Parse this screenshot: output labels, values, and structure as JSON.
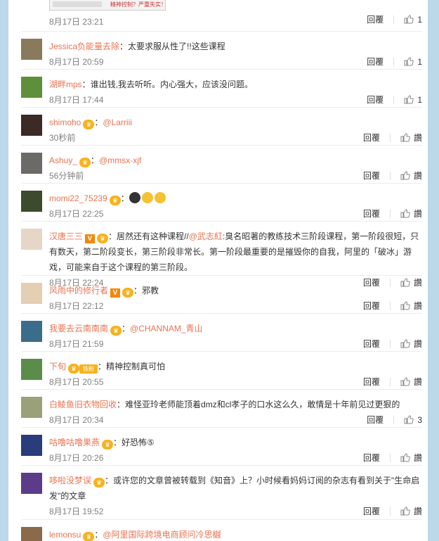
{
  "top": {
    "time": "8月17日 23:21",
    "image_caption": "精神控制？严重失实！",
    "reply": "回覆",
    "likes": "1"
  },
  "comments": [
    {
      "name": "Jessica负能量去除",
      "badges": [],
      "sep": "：",
      "text": "太要求服从性了!!这些课程",
      "time": "8月17日 20:59",
      "reply": "回覆",
      "likes": "1",
      "avatar": "#8a7a5c"
    },
    {
      "name": "湖畔mps",
      "badges": [],
      "sep": "：",
      "text": "谁出钱,我去听听。内心强大，应该没问题。",
      "time": "8月17日 17:44",
      "reply": "回覆",
      "likes": "1",
      "avatar": "#5f8f3a"
    },
    {
      "name": "shimoho",
      "badges": [
        "crown"
      ],
      "sep": "：",
      "mention": "@Larriii",
      "text": "",
      "time": "30秒前",
      "reply": "回覆",
      "likes": "讚",
      "avatar": "#3b2a26"
    },
    {
      "name": "Ashuy_",
      "badges": [
        "crown"
      ],
      "sep": "：",
      "mention": "@mmsx-xjf",
      "text": "",
      "time": "56分钟前",
      "reply": "回覆",
      "likes": "讚",
      "avatar": "#6c6a66"
    },
    {
      "name": "momi22_75239",
      "badges": [
        "crown"
      ],
      "sep": "：",
      "emojis": [
        "#333333",
        "#f5c232",
        "#f5c232"
      ],
      "text": "",
      "time": "8月17日 22:25",
      "reply": "回覆",
      "likes": "讚",
      "avatar": "#3d4a2e"
    },
    {
      "name": "汉唐三三",
      "badges": [
        "v",
        "crown"
      ],
      "sep": "：",
      "text": "居然还有这种课程//",
      "mention": "@武志紅",
      "text2": ":臭名昭著的教练技术三阶段课程，第一阶段很短，只有数天，第二阶段变长，第三阶段非常长。第一阶段最重要的是摧毁你的自我，阿里的「破冰」游戏，可能来自于这个课程的第三阶段。",
      "time": "8月17日 22:24",
      "reply": "回覆",
      "likes": "讚",
      "avatar": "#e6d6c8"
    },
    {
      "name": "风雨中的修行者",
      "badges": [
        "v",
        "crown"
      ],
      "sep": "：",
      "text": "邪教",
      "time": "8月17日 22:12",
      "reply": "回覆",
      "likes": "讚",
      "avatar": "#e4cfb4"
    },
    {
      "name": "我要去云南南南",
      "badges": [
        "crown"
      ],
      "sep": "：",
      "mention": "@CHANNAM_青山",
      "text": "",
      "time": "8月17日 21:59",
      "reply": "回覆",
      "likes": "讚",
      "avatar": "#3c6c8c"
    },
    {
      "name": "下旬",
      "badges": [
        "crown",
        "fan"
      ],
      "sep": "：",
      "text": "精神控制真可怕",
      "time": "8月17日 20:55",
      "reply": "回覆",
      "likes": "讚",
      "avatar": "#5b8c4a"
    },
    {
      "name": "白鲮鱼旧衣物回收",
      "badges": [],
      "sep": "：",
      "text": "难怪亚玲老师能顶着dmz和cl孝子的口水这么久，敢情是十年前见过更狠的",
      "time": "8月17日 20:34",
      "reply": "回覆",
      "likes": "3",
      "avatar": "#9aa07a"
    },
    {
      "name": "咕噜咕噜果燕",
      "badges": [
        "crown"
      ],
      "sep": "：",
      "text": "好恐怖⑤",
      "time": "8月17日 20:26",
      "reply": "回覆",
      "likes": "讚",
      "avatar": "#2a3c7c"
    },
    {
      "name": "哆啦没梦误",
      "badges": [
        "crown"
      ],
      "sep": "：",
      "text": "或许您的文章曾被转载到《知音》上？小时候看妈妈订阅的杂志有看到关于\"生命启发\"的文章",
      "time": "8月17日 19:52",
      "reply": "回覆",
      "likes": "讚",
      "avatar": "#5a3c8a"
    },
    {
      "name": "lemonsu",
      "badges": [
        "crown"
      ],
      "sep": "：",
      "mention": "@阿里国际跨境电商顾问冷思樾",
      "text": "",
      "time": "",
      "reply": "",
      "likes": "",
      "avatar": "#8a6a4a"
    }
  ]
}
